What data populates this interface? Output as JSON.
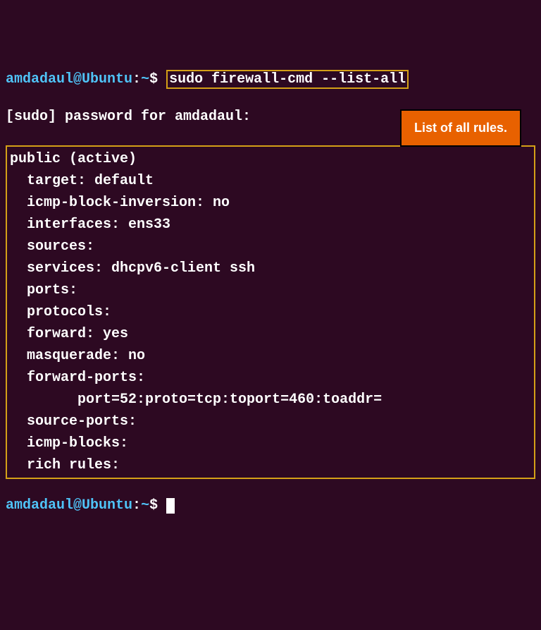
{
  "prompt": {
    "user": "amdadaul",
    "host": "Ubuntu",
    "path": "~",
    "symbol": "$"
  },
  "command": "sudo firewall-cmd --list-all",
  "sudo_prompt": "[sudo] password for amdadaul:",
  "output": {
    "zone_header": "public (active)",
    "target": "  target: default",
    "icmp_block_inversion": "  icmp-block-inversion: no",
    "interfaces": "  interfaces: ens33",
    "sources": "  sources:",
    "services": "  services: dhcpv6-client ssh",
    "ports": "  ports:",
    "protocols": "  protocols:",
    "forward": "  forward: yes",
    "masquerade": "  masquerade: no",
    "forward_ports_label": "  forward-ports:",
    "forward_ports_entry": "        port=52:proto=tcp:toport=460:toaddr=",
    "source_ports": "  source-ports:",
    "icmp_blocks": "  icmp-blocks:",
    "rich_rules": "  rich rules:"
  },
  "annotation": "List of all rules."
}
